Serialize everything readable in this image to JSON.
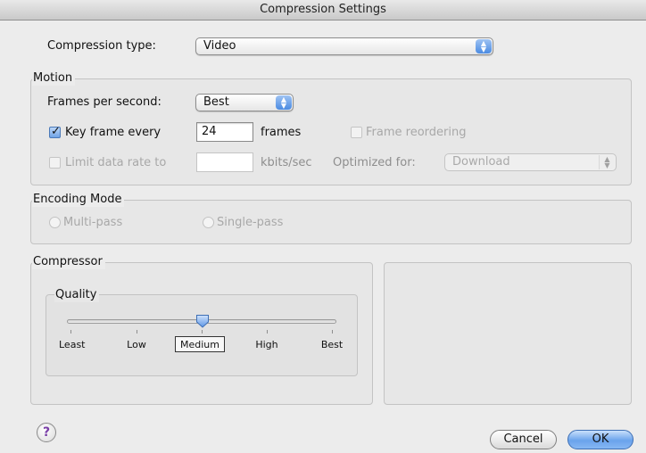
{
  "window": {
    "title": "Compression Settings"
  },
  "compression": {
    "label": "Compression type:",
    "value": "Video"
  },
  "motion": {
    "title": "Motion",
    "fps_label": "Frames per second:",
    "fps_value": "Best",
    "keyframe_label": "Key frame every",
    "keyframe_checked": true,
    "keyframe_value": "24",
    "keyframe_unit": "frames",
    "reorder_label": "Frame reordering",
    "limit_label": "Limit data rate to",
    "limit_value": "",
    "limit_unit": "kbits/sec",
    "optimized_label": "Optimized for:",
    "optimized_value": "Download"
  },
  "encoding": {
    "title": "Encoding Mode",
    "multi_label": "Multi-pass",
    "single_label": "Single-pass"
  },
  "compressor": {
    "title": "Compressor",
    "quality": {
      "title": "Quality",
      "levels": [
        "Least",
        "Low",
        "Medium",
        "High",
        "Best"
      ],
      "selected": "Medium",
      "level_index": 2
    }
  },
  "buttons": {
    "cancel": "Cancel",
    "ok": "OK",
    "help": "?"
  },
  "colors": {
    "accent": "#5a93e3",
    "help_glyph": "#7a3fa8"
  },
  "icons": {
    "popup": "up-down-arrows-icon",
    "check": "checkmark-icon",
    "help": "help-icon"
  }
}
